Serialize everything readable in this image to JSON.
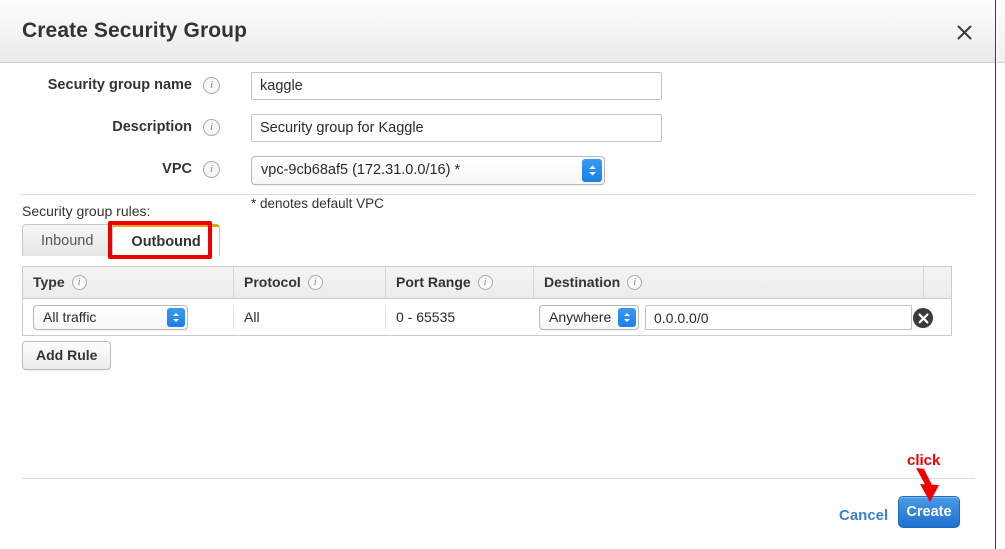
{
  "header": {
    "title": "Create Security Group",
    "close_icon": "close-icon"
  },
  "form": {
    "fields": [
      {
        "label": "Security group name",
        "info_icon": "info-icon",
        "type": "text",
        "value": "kaggle"
      },
      {
        "label": "Description",
        "info_icon": "info-icon",
        "type": "text",
        "value": "Security group for Kaggle"
      },
      {
        "label": "VPC",
        "info_icon": "info-icon",
        "type": "select",
        "value": "vpc-9cb68af5 (172.31.0.0/16) *"
      }
    ],
    "vpc_hint": "* denotes default VPC"
  },
  "rules": {
    "caption": "Security group rules:",
    "tabs": [
      {
        "label": "Inbound",
        "active": false
      },
      {
        "label": "Outbound",
        "active": true
      }
    ],
    "columns": [
      {
        "label": "Type",
        "info_icon": "info-icon"
      },
      {
        "label": "Protocol",
        "info_icon": "info-icon"
      },
      {
        "label": "Port Range",
        "info_icon": "info-icon"
      },
      {
        "label": "Destination",
        "info_icon": "info-icon"
      }
    ],
    "row": {
      "type": "All traffic",
      "protocol": "All",
      "port_range": "0 - 65535",
      "destination_scope": "Anywhere",
      "destination_cidr": "0.0.0.0/0",
      "remove_icon": "remove-circle-icon"
    },
    "add_rule_label": "Add Rule"
  },
  "footer": {
    "cancel_label": "Cancel",
    "create_label": "Create"
  },
  "annotations": {
    "click_label": "click",
    "arrow_icon": "down-arrow-icon",
    "highlight_color": "#ee0000"
  }
}
